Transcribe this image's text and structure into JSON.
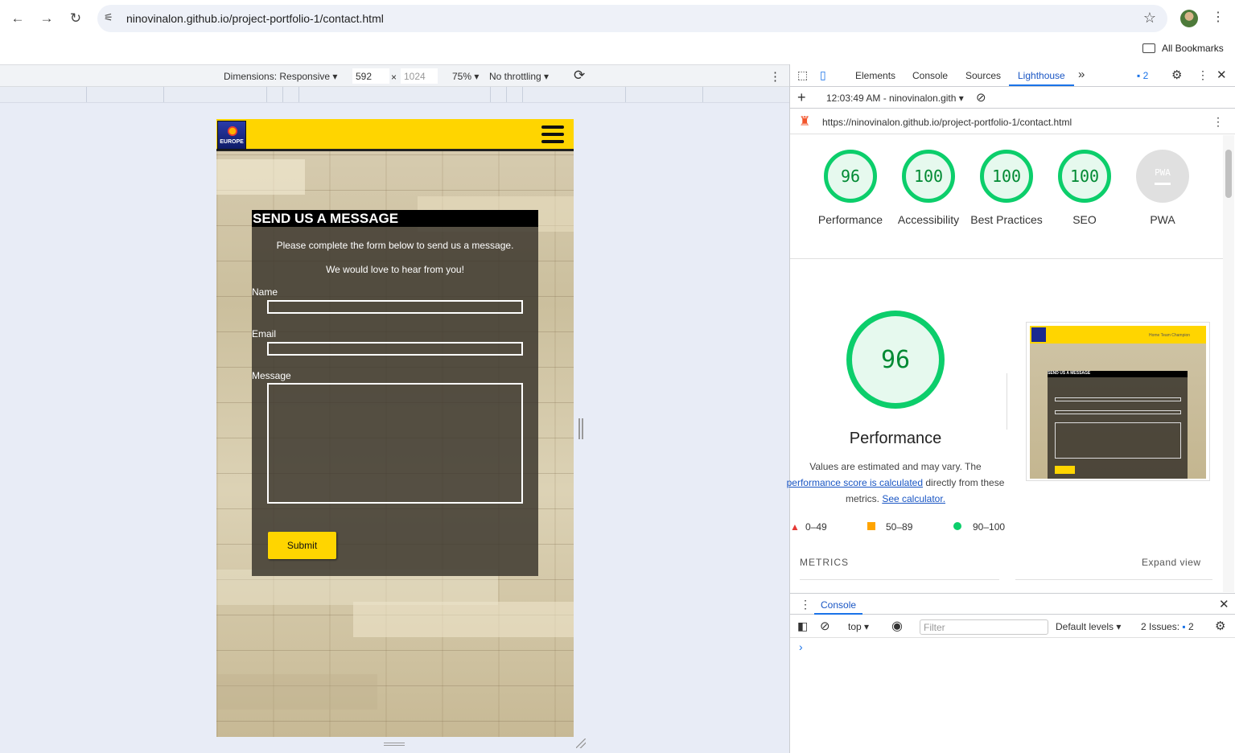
{
  "browser": {
    "url": "ninovinalon.github.io/project-portfolio-1/contact.html",
    "bookmarks_label": "All Bookmarks",
    "icons": {
      "back": "←",
      "forward": "→",
      "reload": "↻",
      "star": "☆",
      "kebab": "⋮",
      "tune": "⚟"
    }
  },
  "device_toolbar": {
    "dimensions_label": "Dimensions: Responsive",
    "width": "592",
    "times": "×",
    "height": "1024",
    "zoom": "75%",
    "throttling": "No throttling",
    "rotate_icon": "⟳"
  },
  "site": {
    "logo_text": "EUROPE",
    "form_title": "SEND US A MESSAGE",
    "intro1": "Please complete the form below to send us a message.",
    "intro2": "We would love to hear from you!",
    "name_label": "Name",
    "email_label": "Email",
    "message_label": "Message",
    "submit_label": "Submit"
  },
  "devtools": {
    "tabs": [
      "Elements",
      "Console",
      "Sources",
      "Lighthouse"
    ],
    "active_tab": "Lighthouse",
    "more_tabs": "»",
    "issues_count": "2",
    "report_time": "12:03:49 AM - ninovinalon.gith",
    "report_url": "https://ninovinalon.github.io/project-portfolio-1/contact.html",
    "scores": [
      {
        "value": "96",
        "label": "Performance"
      },
      {
        "value": "100",
        "label": "Accessibility"
      },
      {
        "value": "100",
        "label": "Best Practices"
      },
      {
        "value": "100",
        "label": "SEO"
      },
      {
        "value": "PWA",
        "label": "PWA"
      }
    ],
    "perf_score": "96",
    "perf_title": "Performance",
    "perf_note_1": "Values are estimated and may vary. The",
    "perf_link_1": "performance score is calculated",
    "perf_note_2": "directly from these",
    "perf_note_3": "metrics.",
    "perf_link_2": "See calculator.",
    "legend": [
      "0–49",
      "50–89",
      "90–100"
    ],
    "metrics_label": "METRICS",
    "expand_label": "Expand view",
    "shot_title": "SEND US A MESSAGE",
    "shot_nav": "Home  Team  Champion"
  },
  "console": {
    "tab": "Console",
    "context": "top",
    "filter_placeholder": "Filter",
    "levels": "Default levels",
    "issues_label": "2 Issues:",
    "issues_count": "2",
    "prompt": "›"
  },
  "colors": {
    "accent_yellow": "#ffd500",
    "score_green": "#0cce6b",
    "link_blue": "#1a56c4"
  }
}
